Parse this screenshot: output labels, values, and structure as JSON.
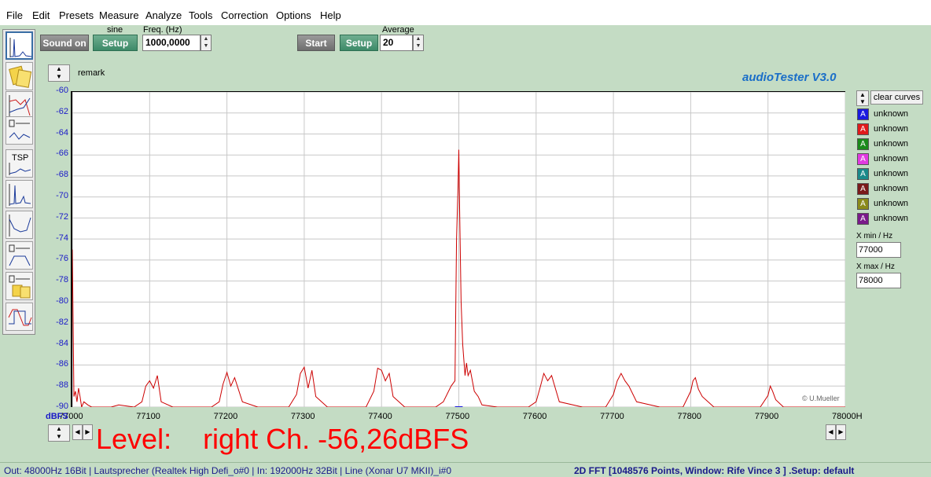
{
  "menu": [
    "File",
    "Edit",
    "Presets",
    "Measure",
    "Analyze",
    "Tools",
    "Correction",
    "Options",
    "Help"
  ],
  "toolbar": {
    "sound_on": "Sound on",
    "sine_label": "sine",
    "setup1": "Setup",
    "freq_label": "Freq. (Hz)",
    "freq_value": "1000,0000",
    "start": "Start",
    "setup2": "Setup",
    "average_label": "Average",
    "average_value": "20"
  },
  "remark": "remark",
  "brand": "audioTester  V3.0",
  "legend": {
    "clear_curves": "clear curves",
    "curves": [
      {
        "label": "unknown",
        "color": "#1a1ae0"
      },
      {
        "label": "unknown",
        "color": "#e01a1a"
      },
      {
        "label": "unknown",
        "color": "#1a8a1a"
      },
      {
        "label": "unknown",
        "color": "#e03ae0"
      },
      {
        "label": "unknown",
        "color": "#1a8a8a"
      },
      {
        "label": "unknown",
        "color": "#7a1a1a"
      },
      {
        "label": "unknown",
        "color": "#8a8a1a"
      },
      {
        "label": "unknown",
        "color": "#7a1a8a"
      }
    ],
    "xmin_label": "X min / Hz",
    "xmin_value": "77000",
    "xmax_label": "X max / Hz",
    "xmax_value": "78000"
  },
  "level_text": "Level:    right Ch. -56,26dBFS",
  "copyright": "© U.Mueller",
  "status": {
    "left": "Out: 48000Hz 16Bit  | Lautsprecher (Realtek High Defi_o#0  | In: 192000Hz 32Bit  | Line (Xonar U7 MKII)_i#0",
    "right": "2D FFT [1048576 Points, Window: Rife Vince 3 ]  .Setup:  default"
  },
  "chart_data": {
    "type": "line",
    "ylabel": "dBFS",
    "xlim": [
      77000,
      78000
    ],
    "ylim": [
      -90,
      -60
    ],
    "x_ticks": [
      "77000",
      "77100",
      "77200",
      "77300",
      "77400",
      "77500",
      "77600",
      "77700",
      "77800",
      "77900",
      "78000H"
    ],
    "y_ticks": [
      "-60",
      "-62",
      "-64",
      "-66",
      "-68",
      "-70",
      "-72",
      "-74",
      "-76",
      "-78",
      "-80",
      "-82",
      "-84",
      "-86",
      "-88",
      "-90"
    ],
    "grid": true,
    "series": [
      {
        "color": "#cc0000",
        "x": [
          77000,
          77002,
          77004,
          77006,
          77008,
          77010,
          77012,
          77015,
          77020,
          77025,
          77030,
          77040,
          77050,
          77060,
          77080,
          77090,
          77095,
          77100,
          77105,
          77110,
          77115,
          77130,
          77150,
          77180,
          77190,
          77195,
          77200,
          77205,
          77210,
          77220,
          77240,
          77260,
          77280,
          77290,
          77295,
          77300,
          77305,
          77310,
          77315,
          77330,
          77360,
          77380,
          77390,
          77395,
          77400,
          77405,
          77410,
          77415,
          77430,
          77450,
          77470,
          77480,
          77490,
          77495,
          77497,
          77499,
          77500,
          77501,
          77503,
          77505,
          77508,
          77510,
          77512,
          77515,
          77520,
          77525,
          77530,
          77550,
          77570,
          77590,
          77600,
          77605,
          77610,
          77615,
          77620,
          77630,
          77660,
          77690,
          77700,
          77705,
          77710,
          77715,
          77720,
          77730,
          77760,
          77790,
          77800,
          77803,
          77806,
          77810,
          77815,
          77830,
          77870,
          77890,
          77900,
          77903,
          77906,
          77910,
          77920,
          77950,
          78000
        ],
        "y": [
          -75,
          -89,
          -88.5,
          -89.5,
          -88.2,
          -89,
          -90,
          -89.5,
          -89.8,
          -90,
          -90,
          -90,
          -90,
          -89.8,
          -90,
          -89.5,
          -88,
          -87.5,
          -88.2,
          -87,
          -89.5,
          -90,
          -90,
          -90,
          -89.5,
          -87.8,
          -86.7,
          -88,
          -87.2,
          -89.5,
          -90,
          -90,
          -90,
          -88.8,
          -86.8,
          -86.2,
          -88.2,
          -86.5,
          -89,
          -90,
          -90,
          -90,
          -88.5,
          -86.3,
          -86.5,
          -87.5,
          -86.8,
          -89,
          -90,
          -90,
          -90,
          -89.5,
          -88,
          -87.5,
          -74,
          -69,
          -65.5,
          -71,
          -80,
          -84,
          -87,
          -85.8,
          -87,
          -86.5,
          -88.5,
          -89,
          -89.8,
          -90,
          -90,
          -90,
          -89.5,
          -88.2,
          -86.8,
          -87.5,
          -87,
          -89.5,
          -90,
          -90,
          -88.8,
          -87.5,
          -86.8,
          -87.5,
          -88,
          -89.5,
          -90,
          -90,
          -88.5,
          -87.5,
          -87.2,
          -88.3,
          -89,
          -90,
          -90,
          -90,
          -88.9,
          -88,
          -88.5,
          -89.3,
          -90,
          -90,
          -90
        ]
      },
      {
        "color": "#1a1ae0",
        "x": [
          77495,
          77500,
          77505
        ],
        "y": [
          -90,
          -90,
          -90
        ]
      }
    ]
  }
}
